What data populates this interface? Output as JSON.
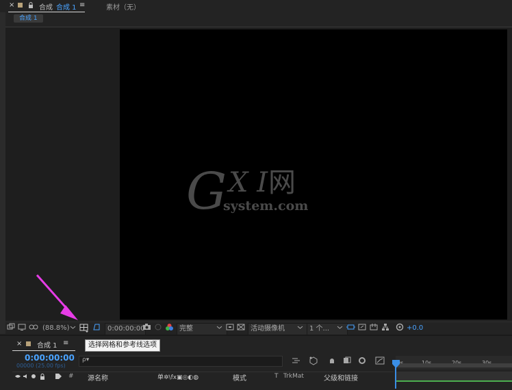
{
  "comp_panel": {
    "close": "×",
    "panel_label": "合成",
    "active_tab": "合成 1",
    "menu": "≡",
    "footage_tab": "素材（无）",
    "subtab": "合成 1"
  },
  "watermark": {
    "g": "G",
    "xi": "X I",
    "net": "网",
    "domain": "system.com"
  },
  "viewer_toolbar": {
    "zoom": "(88.8%)",
    "timecode": "0:00:00:00",
    "resolution": "完整",
    "camera": "活动摄像机",
    "views": "1 个...",
    "exposure": "+0.0"
  },
  "tooltip": "选择网格和参考线选项",
  "timeline": {
    "close": "×",
    "tab": "合成 1",
    "menu": "≡",
    "timecode": "0:00:00:00",
    "fps": "00000 (25.00 fps)",
    "search_placeholder": "ρ▾",
    "columns": {
      "num": "#",
      "source_name": "源名称",
      "switches": "单✲\\fx▣◎◐◍",
      "mode": "模式",
      "t": "T",
      "trkmat": "TrkMat",
      "parent": "父级和链接"
    },
    "ruler": [
      "0s",
      "10s",
      "20s",
      "30s"
    ]
  },
  "colors": {
    "accent": "#4aa3ff",
    "arrow": "#e63ce6",
    "canvas": "#000000",
    "panel": "#232323"
  }
}
